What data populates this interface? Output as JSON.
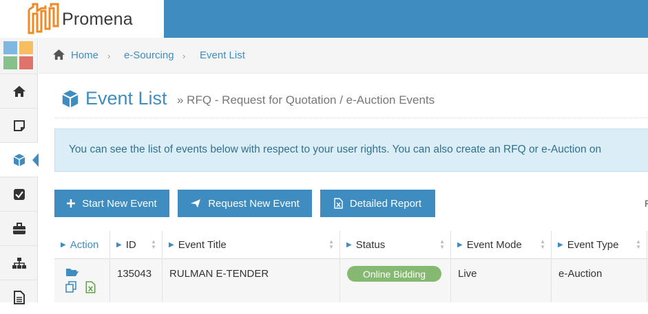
{
  "brand": {
    "name": "Promena"
  },
  "sidebar": {
    "items": [
      {
        "icon": "home-icon",
        "active": false
      },
      {
        "icon": "note-icon",
        "active": false
      },
      {
        "icon": "cube-icon",
        "active": true
      },
      {
        "icon": "checkbox-icon",
        "active": false
      },
      {
        "icon": "briefcase-icon",
        "active": false
      },
      {
        "icon": "sitemap-icon",
        "active": false
      },
      {
        "icon": "document-icon",
        "active": false
      }
    ]
  },
  "breadcrumb": [
    "Home",
    "e-Sourcing",
    "Event List"
  ],
  "page": {
    "title": "Event List",
    "subtitle": "» RFQ - Request for Quotation / e-Auction Events",
    "info": "You can see the list of events below with respect to your user rights. You can also create an RFQ or e-Auction on"
  },
  "toolbar": {
    "start_label": "Start New Event",
    "request_label": "Request New Event",
    "report_label": "Detailed Report",
    "right_fragment": "F"
  },
  "table": {
    "headers": [
      "Action",
      "ID",
      "Event Title",
      "Status",
      "Event Mode",
      "Event Type"
    ],
    "rows": [
      {
        "id": "135043",
        "title": "RULMAN E-TENDER",
        "status": "Online Bidding",
        "mode": "Live",
        "type": "e-Auction"
      }
    ]
  },
  "colors": {
    "primary": "#3f8dc0",
    "status_online": "#85b870",
    "info_bg": "#dbeef7"
  }
}
